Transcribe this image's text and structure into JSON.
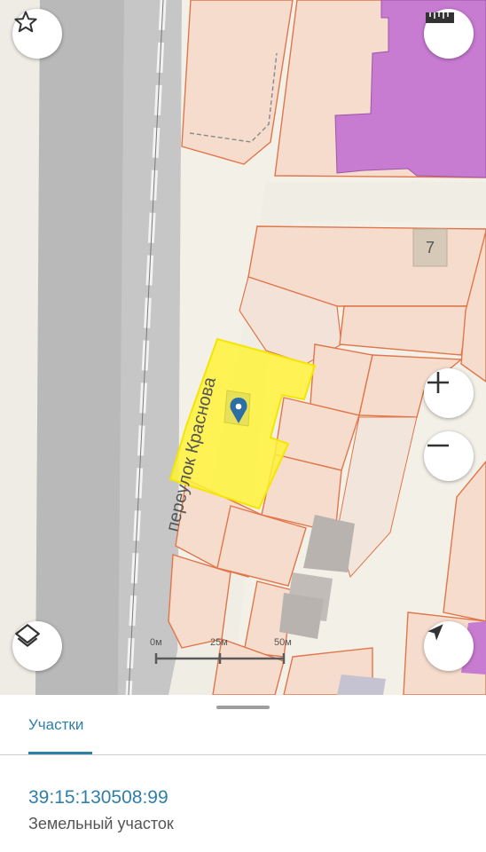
{
  "map": {
    "street_label": "переулок Краснова",
    "building_number": "7",
    "selected_parcel_color": "#fff23a",
    "parcel_border_color": "#e0764a",
    "building_color": "#c77bd1",
    "controls": {
      "favorite_icon": "star-icon",
      "ruler_icon": "ruler-icon",
      "zoom_in_icon": "plus-icon",
      "zoom_out_icon": "minus-icon",
      "layers_icon": "layers-icon",
      "location_icon": "navigation-arrow-icon"
    },
    "scale": {
      "labels": [
        "0м",
        "25м",
        "50м"
      ]
    }
  },
  "sheet": {
    "tab_label": "Участки",
    "parcel": {
      "number": "39:15:130508:99",
      "type": "Земельный участок"
    }
  }
}
